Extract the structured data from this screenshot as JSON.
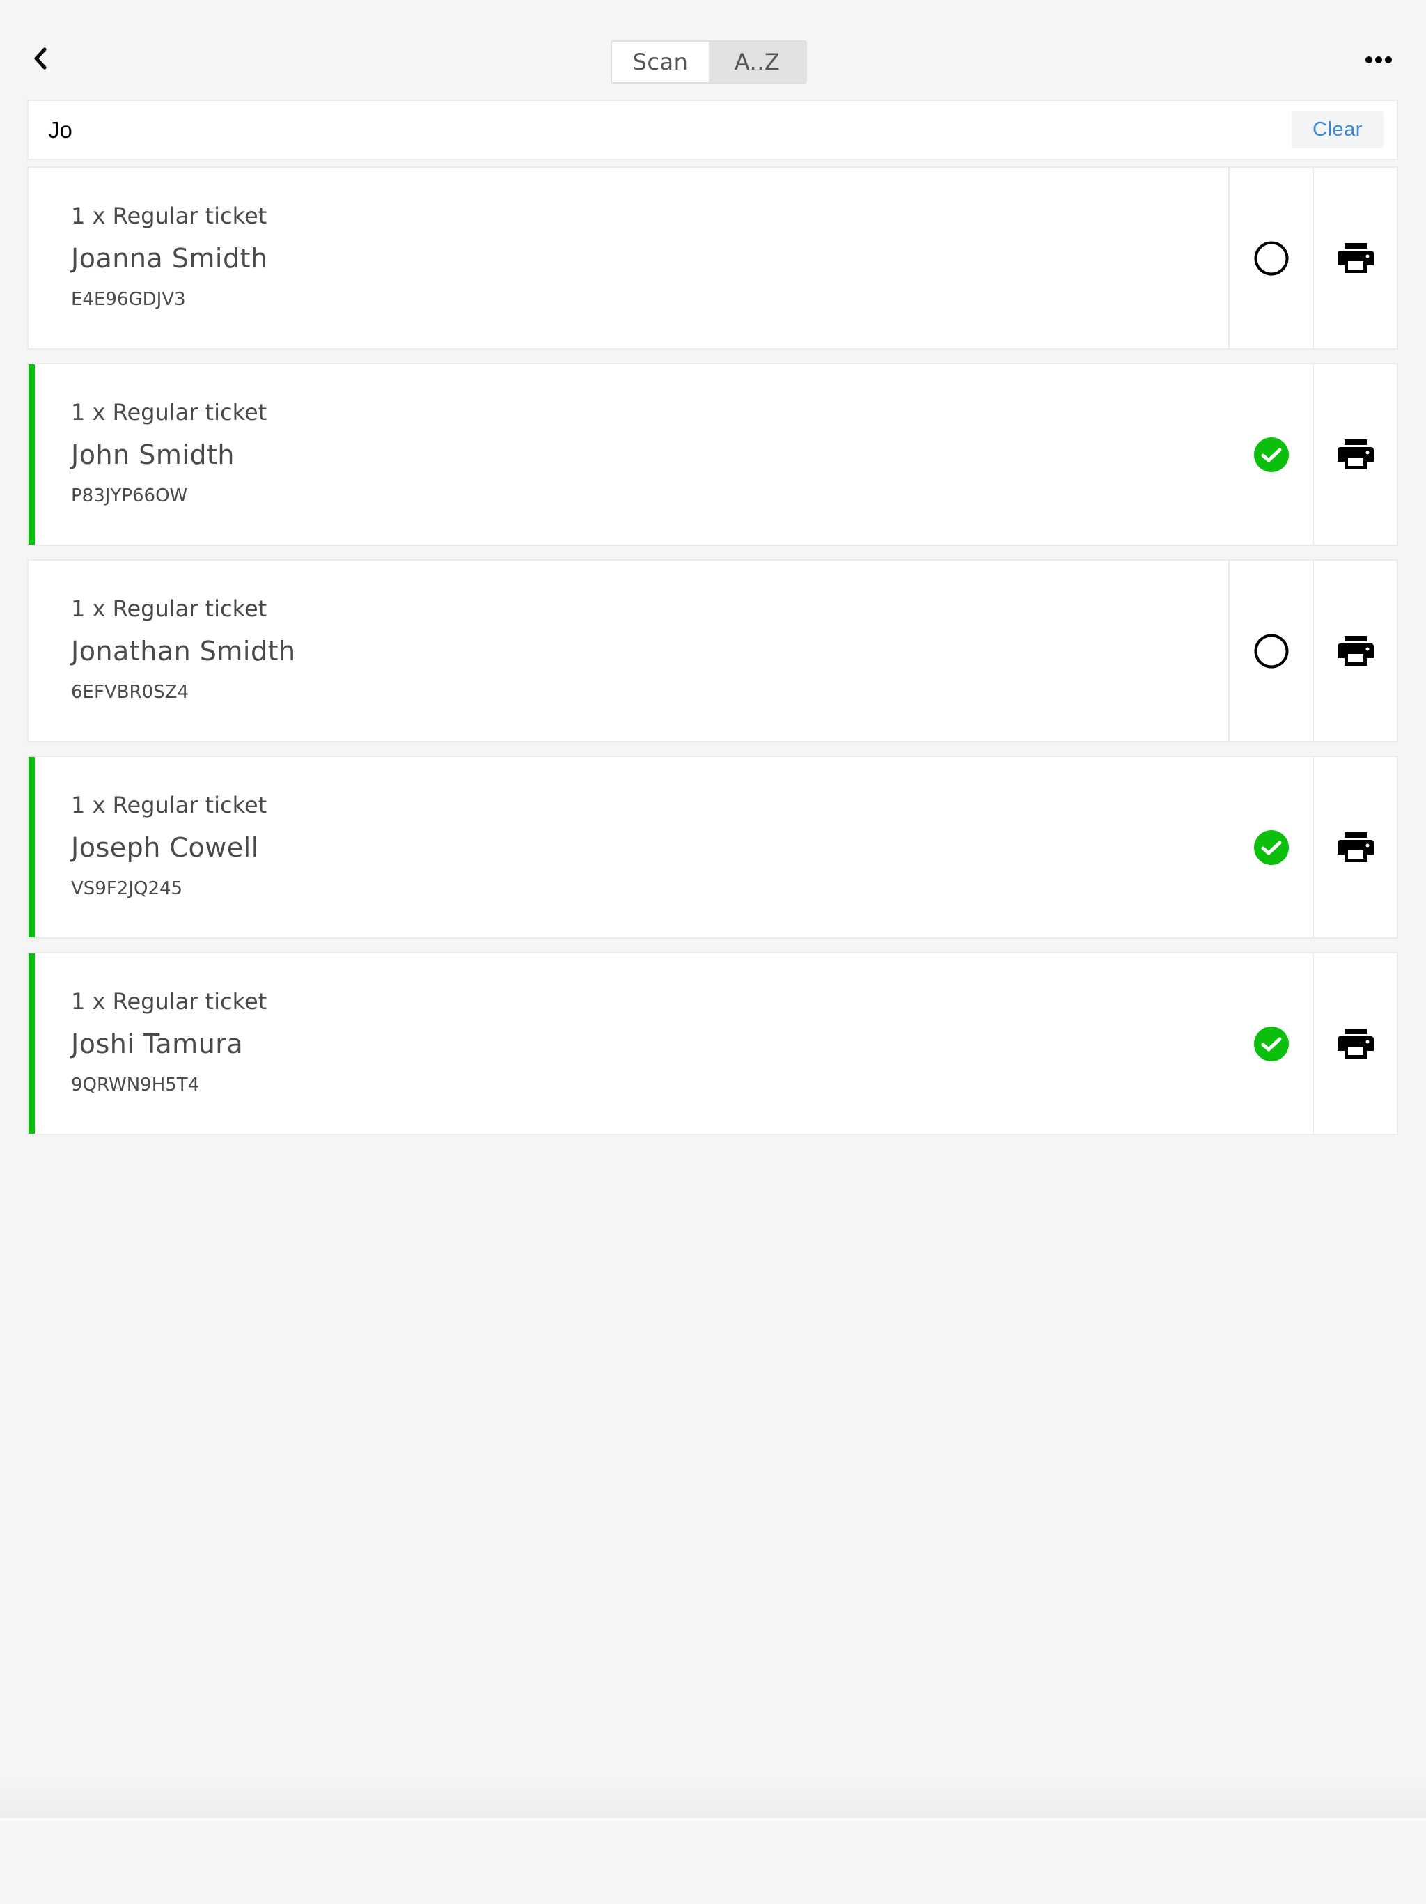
{
  "nav": {
    "back_icon": "chevron-left-icon",
    "more_icon": "ellipsis-icon",
    "segments": [
      {
        "label": "Scan",
        "active": false
      },
      {
        "label": "A..Z",
        "active": true
      }
    ]
  },
  "search": {
    "value": "Jo",
    "placeholder": "",
    "clear_label": "Clear"
  },
  "colors": {
    "checked_accent": "#0dbf0d",
    "link": "#3b86d6",
    "background": "#f5f5f5"
  },
  "tickets": [
    {
      "type": "1 x Regular ticket",
      "name": "Joanna Smidth",
      "code": "E4E96GDJV3",
      "checked_in": false,
      "status_icon": "empty-circle-icon",
      "print_icon": "printer-icon"
    },
    {
      "type": "1 x Regular ticket",
      "name": "John Smidth",
      "code": "P83JYP66OW",
      "checked_in": true,
      "status_icon": "check-circle-icon",
      "print_icon": "printer-icon"
    },
    {
      "type": "1 x Regular ticket",
      "name": "Jonathan Smidth",
      "code": "6EFVBR0SZ4",
      "checked_in": false,
      "status_icon": "empty-circle-icon",
      "print_icon": "printer-icon"
    },
    {
      "type": "1 x Regular ticket",
      "name": "Joseph Cowell",
      "code": "VS9F2JQ245",
      "checked_in": true,
      "status_icon": "check-circle-icon",
      "print_icon": "printer-icon"
    },
    {
      "type": "1 x Regular ticket",
      "name": "Joshi Tamura",
      "code": "9QRWN9H5T4",
      "checked_in": true,
      "status_icon": "check-circle-icon",
      "print_icon": "printer-icon"
    }
  ]
}
